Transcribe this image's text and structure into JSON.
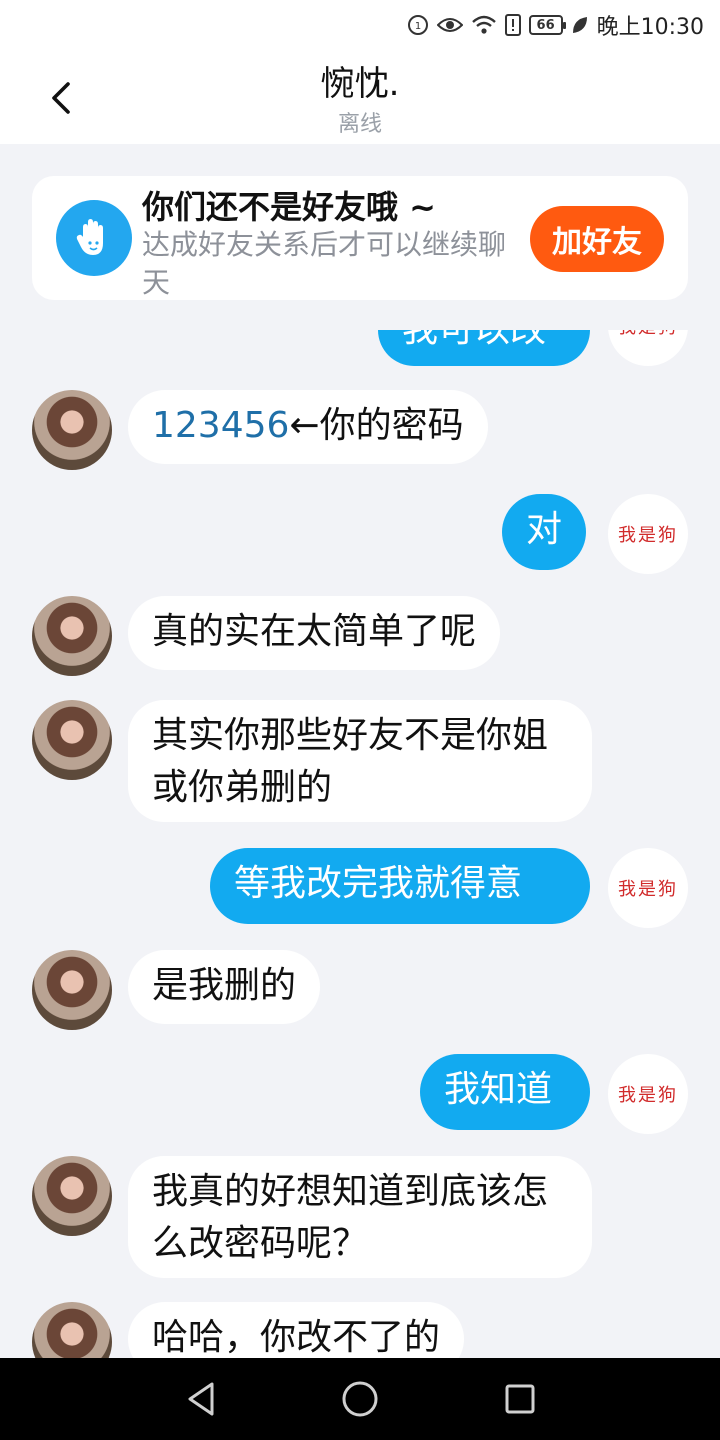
{
  "status_bar": {
    "battery": "66",
    "time": "晚上10:30"
  },
  "header": {
    "title": "惋忱.",
    "subtitle": "离线"
  },
  "banner": {
    "title": "你们还不是好友哦 ~",
    "description": "达成好友关系后才可以继续聊天",
    "button_label": "加好友"
  },
  "right_avatar_text": "我是狗",
  "messages": [
    {
      "side": "out",
      "text": "我可以改",
      "partial": true
    },
    {
      "side": "in",
      "link_text": "123456",
      "text": "←你的密码"
    },
    {
      "side": "out",
      "text": "对"
    },
    {
      "side": "in",
      "text": "真的实在太简单了呢"
    },
    {
      "side": "in",
      "text": "其实你那些好友不是你姐或你弟删的"
    },
    {
      "side": "out",
      "text": "等我改完我就得意"
    },
    {
      "side": "in",
      "text": "是我删的"
    },
    {
      "side": "out",
      "text": "我知道"
    },
    {
      "side": "in",
      "text": "我真的好想知道到底该怎么改密码呢？"
    },
    {
      "side": "in",
      "text": "哈哈，你改不了的",
      "partial": true
    }
  ],
  "colors": {
    "outgoing_bubble": "#12aaf0",
    "add_button": "#ff5a10",
    "background": "#f2f3f7"
  }
}
